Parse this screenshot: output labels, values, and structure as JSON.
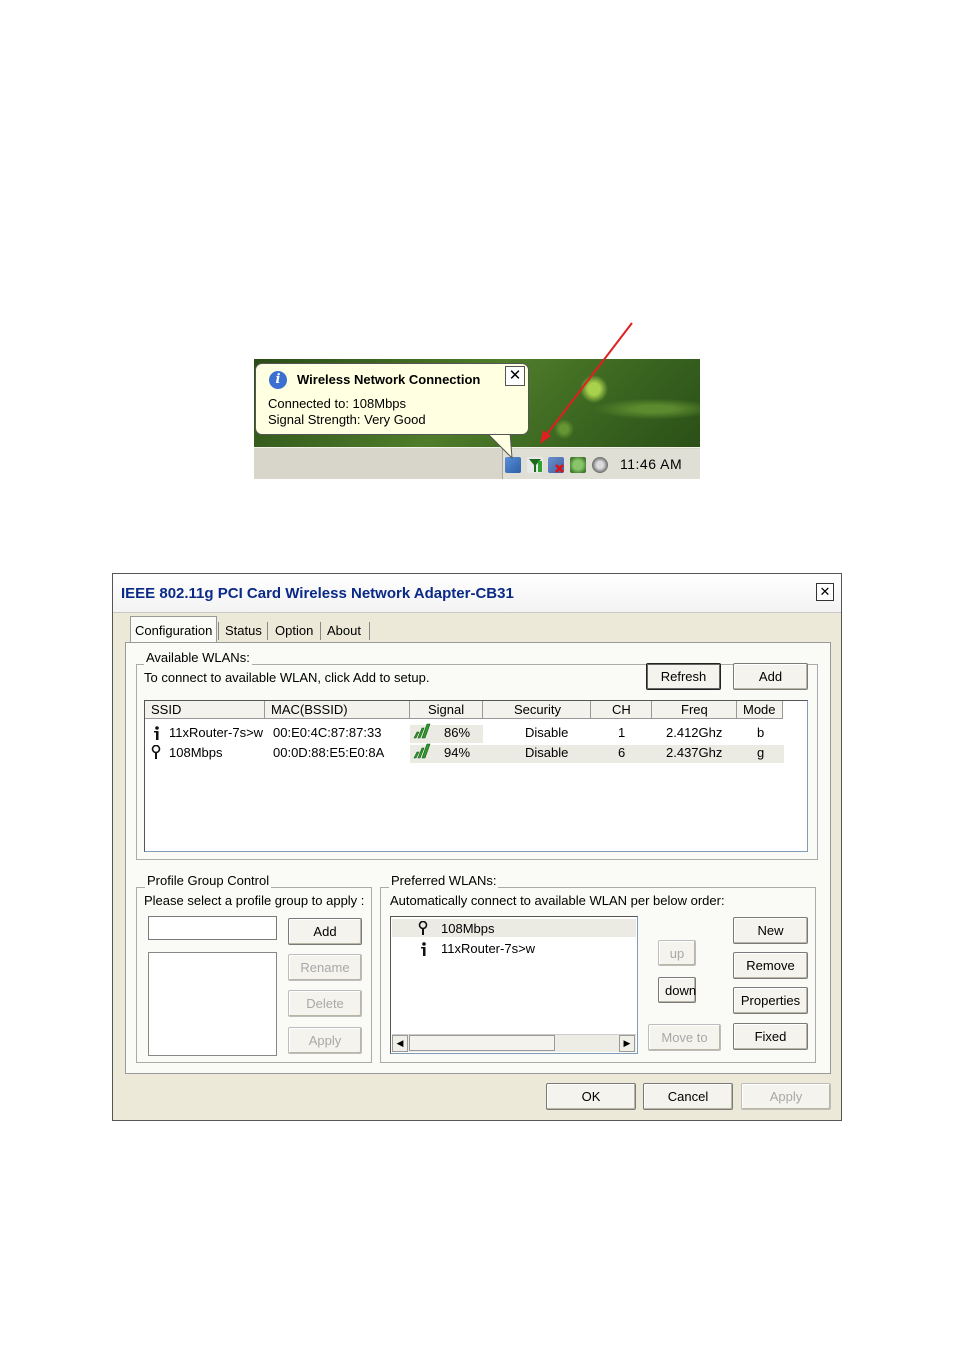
{
  "tray": {
    "balloon": {
      "title": "Wireless Network Connection",
      "line1": "Connected to: 108Mbps",
      "line2": "Signal Strength: Very Good",
      "close_label": "✕"
    },
    "clock": "11:46 AM"
  },
  "dialog": {
    "title": "IEEE 802.11g  PCI Card  Wireless Network Adapter-CB31",
    "close_label": "✕",
    "tabs": [
      {
        "label": "Configuration",
        "active": true
      },
      {
        "label": "Status"
      },
      {
        "label": "Option"
      },
      {
        "label": "About"
      }
    ],
    "available": {
      "group_label": "Available WLANs:",
      "hint": "To connect to available WLAN, click Add to setup.",
      "refresh_label": "Refresh",
      "add_label": "Add",
      "columns": [
        "SSID",
        "MAC(BSSID)",
        "Signal",
        "Security",
        "CH",
        "Freq",
        "Mode"
      ],
      "rows": [
        {
          "ssid": "11xRouter-7s>w",
          "mac": "00:E0:4C:87:87:33",
          "signal": "86%",
          "security": "Disable",
          "ch": "1",
          "freq": "2.412Ghz",
          "mode": "b"
        },
        {
          "ssid": "108Mbps",
          "mac": "00:0D:88:E5:E0:8A",
          "signal": "94%",
          "security": "Disable",
          "ch": "6",
          "freq": "2.437Ghz",
          "mode": "g"
        }
      ]
    },
    "profile_group": {
      "group_label": "Profile Group Control",
      "hint": "Please select a profile group to apply :",
      "input_value": "",
      "add_label": "Add",
      "rename_label": "Rename",
      "delete_label": "Delete",
      "apply_label": "Apply"
    },
    "preferred": {
      "group_label": "Preferred WLANs:",
      "hint": "Automatically connect to available WLAN per below order:",
      "items": [
        "108Mbps",
        "11xRouter-7s>w"
      ],
      "up_label": "up",
      "down_label": "down",
      "move_to_label": "Move to",
      "new_label": "New",
      "remove_label": "Remove",
      "properties_label": "Properties",
      "fixed_label": "Fixed"
    },
    "footer": {
      "ok_label": "OK",
      "cancel_label": "Cancel",
      "apply_label": "Apply"
    }
  }
}
